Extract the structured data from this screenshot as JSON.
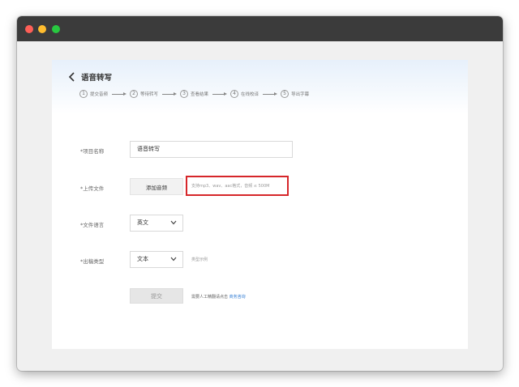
{
  "page": {
    "title": "语音转写"
  },
  "steps": [
    {
      "num": "1",
      "label": "提交音频"
    },
    {
      "num": "2",
      "label": "等待转写"
    },
    {
      "num": "3",
      "label": "查看结果"
    },
    {
      "num": "4",
      "label": "在线校译"
    },
    {
      "num": "5",
      "label": "导出字幕"
    }
  ],
  "form": {
    "project_name_label": "*项目名称",
    "project_name_value": "语音转写",
    "upload_label": "*上传文件",
    "add_audio_label": "添加音频",
    "upload_hint": "支持mp3、wav、aac格式，音频 ≤ 500M",
    "language_label": "*文件语言",
    "language_value": "英文",
    "output_type_label": "*出稿类型",
    "output_type_value": "文本",
    "output_sample_link": "类型示例",
    "submit_label": "提交",
    "note_prefix": "需要人工精翻请点击",
    "note_link": "商务咨询"
  },
  "colors": {
    "highlight_border": "#d6262a",
    "link": "#2f7bd3",
    "titlebar": "#3b3b3b"
  },
  "icons": {
    "back": "chevron-left-icon",
    "dropdown": "chevron-down-icon"
  }
}
